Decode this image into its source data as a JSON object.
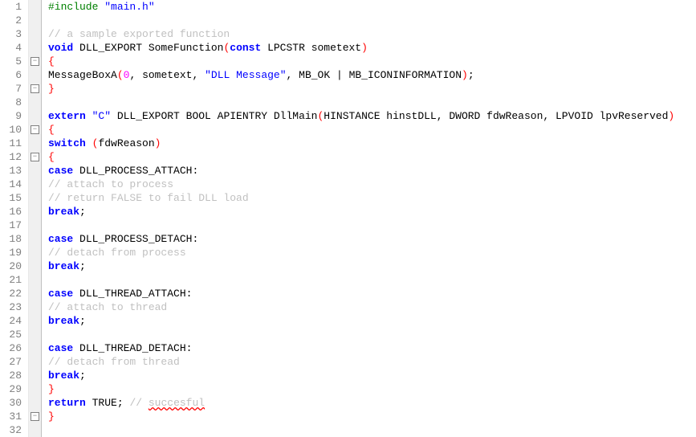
{
  "lineCount": 32,
  "folds": [
    5,
    7,
    10,
    12,
    31
  ],
  "lines": [
    {
      "n": 1,
      "tokens": [
        {
          "c": "pp",
          "t": "#include "
        },
        {
          "c": "str",
          "t": "\"main.h\""
        }
      ]
    },
    {
      "n": 2,
      "tokens": []
    },
    {
      "n": 3,
      "tokens": [
        {
          "c": "cmt",
          "t": "// a sample exported function"
        }
      ]
    },
    {
      "n": 4,
      "tokens": [
        {
          "c": "kw",
          "t": "void"
        },
        {
          "t": " DLL_EXPORT SomeFunction"
        },
        {
          "c": "paren",
          "t": "("
        },
        {
          "c": "kw",
          "t": "const"
        },
        {
          "t": " LPCSTR sometext"
        },
        {
          "c": "paren",
          "t": ")"
        }
      ]
    },
    {
      "n": 5,
      "tokens": [
        {
          "c": "brace",
          "t": "{"
        }
      ]
    },
    {
      "n": 6,
      "tokens": [
        {
          "t": "    MessageBoxA"
        },
        {
          "c": "paren",
          "t": "("
        },
        {
          "c": "num",
          "t": "0"
        },
        {
          "c": "punct",
          "t": ","
        },
        {
          "t": " sometext"
        },
        {
          "c": "punct",
          "t": ","
        },
        {
          "t": " "
        },
        {
          "c": "str",
          "t": "\"DLL Message\""
        },
        {
          "c": "punct",
          "t": ","
        },
        {
          "t": " MB_OK "
        },
        {
          "c": "punct",
          "t": "|"
        },
        {
          "t": " MB_ICONINFORMATION"
        },
        {
          "c": "paren",
          "t": ")"
        },
        {
          "c": "punct",
          "t": ";"
        }
      ]
    },
    {
      "n": 7,
      "tokens": [
        {
          "c": "brace",
          "t": "}"
        }
      ]
    },
    {
      "n": 8,
      "tokens": []
    },
    {
      "n": 9,
      "tokens": [
        {
          "c": "kw",
          "t": "extern"
        },
        {
          "t": " "
        },
        {
          "c": "str",
          "t": "\"C\""
        },
        {
          "t": " DLL_EXPORT BOOL APIENTRY DllMain"
        },
        {
          "c": "paren",
          "t": "("
        },
        {
          "t": "HINSTANCE hinstDLL"
        },
        {
          "c": "punct",
          "t": ","
        },
        {
          "t": " DWORD fdwReason"
        },
        {
          "c": "punct",
          "t": ","
        },
        {
          "t": " LPVOID lpvReserved"
        },
        {
          "c": "paren",
          "t": ")"
        }
      ]
    },
    {
      "n": 10,
      "tokens": [
        {
          "c": "brace",
          "t": "{"
        }
      ]
    },
    {
      "n": 11,
      "tokens": [
        {
          "t": "    "
        },
        {
          "c": "kw",
          "t": "switch"
        },
        {
          "t": " "
        },
        {
          "c": "paren",
          "t": "("
        },
        {
          "t": "fdwReason"
        },
        {
          "c": "paren",
          "t": ")"
        }
      ]
    },
    {
      "n": 12,
      "tokens": [
        {
          "t": "    "
        },
        {
          "c": "brace",
          "t": "{"
        }
      ]
    },
    {
      "n": 13,
      "tokens": [
        {
          "t": "        "
        },
        {
          "c": "kw",
          "t": "case"
        },
        {
          "t": " DLL_PROCESS_ATTACH"
        },
        {
          "c": "punct",
          "t": ":"
        }
      ]
    },
    {
      "n": 14,
      "tokens": [
        {
          "t": "            "
        },
        {
          "c": "cmt",
          "t": "// attach to process"
        }
      ]
    },
    {
      "n": 15,
      "tokens": [
        {
          "t": "            "
        },
        {
          "c": "cmt",
          "t": "// return FALSE to fail DLL load"
        }
      ]
    },
    {
      "n": 16,
      "tokens": [
        {
          "t": "            "
        },
        {
          "c": "kw",
          "t": "break"
        },
        {
          "c": "punct",
          "t": ";"
        }
      ]
    },
    {
      "n": 17,
      "tokens": []
    },
    {
      "n": 18,
      "tokens": [
        {
          "t": "        "
        },
        {
          "c": "kw",
          "t": "case"
        },
        {
          "t": " DLL_PROCESS_DETACH"
        },
        {
          "c": "punct",
          "t": ":"
        }
      ]
    },
    {
      "n": 19,
      "tokens": [
        {
          "t": "            "
        },
        {
          "c": "cmt",
          "t": "// detach from process"
        }
      ]
    },
    {
      "n": 20,
      "tokens": [
        {
          "t": "            "
        },
        {
          "c": "kw",
          "t": "break"
        },
        {
          "c": "punct",
          "t": ";"
        }
      ]
    },
    {
      "n": 21,
      "tokens": []
    },
    {
      "n": 22,
      "tokens": [
        {
          "t": "        "
        },
        {
          "c": "kw",
          "t": "case"
        },
        {
          "t": " DLL_THREAD_ATTACH"
        },
        {
          "c": "punct",
          "t": ":"
        }
      ]
    },
    {
      "n": 23,
      "tokens": [
        {
          "t": "            "
        },
        {
          "c": "cmt",
          "t": "// attach to thread"
        }
      ]
    },
    {
      "n": 24,
      "tokens": [
        {
          "t": "            "
        },
        {
          "c": "kw",
          "t": "break"
        },
        {
          "c": "punct",
          "t": ";"
        }
      ]
    },
    {
      "n": 25,
      "tokens": []
    },
    {
      "n": 26,
      "tokens": [
        {
          "t": "        "
        },
        {
          "c": "kw",
          "t": "case"
        },
        {
          "t": " DLL_THREAD_DETACH"
        },
        {
          "c": "punct",
          "t": ":"
        }
      ]
    },
    {
      "n": 27,
      "tokens": [
        {
          "t": "            "
        },
        {
          "c": "cmt",
          "t": "// detach from thread"
        }
      ]
    },
    {
      "n": 28,
      "tokens": [
        {
          "t": "            "
        },
        {
          "c": "kw",
          "t": "break"
        },
        {
          "c": "punct",
          "t": ";"
        }
      ]
    },
    {
      "n": 29,
      "tokens": [
        {
          "t": "    "
        },
        {
          "c": "brace",
          "t": "}"
        }
      ]
    },
    {
      "n": 30,
      "tokens": [
        {
          "t": "    "
        },
        {
          "c": "kw",
          "t": "return"
        },
        {
          "t": " TRUE"
        },
        {
          "c": "punct",
          "t": ";"
        },
        {
          "t": " "
        },
        {
          "c": "cmt",
          "t": "// "
        },
        {
          "c": "cmt2",
          "t": "succesful"
        }
      ]
    },
    {
      "n": 31,
      "tokens": [
        {
          "c": "brace",
          "t": "}"
        }
      ]
    },
    {
      "n": 32,
      "tokens": []
    }
  ]
}
